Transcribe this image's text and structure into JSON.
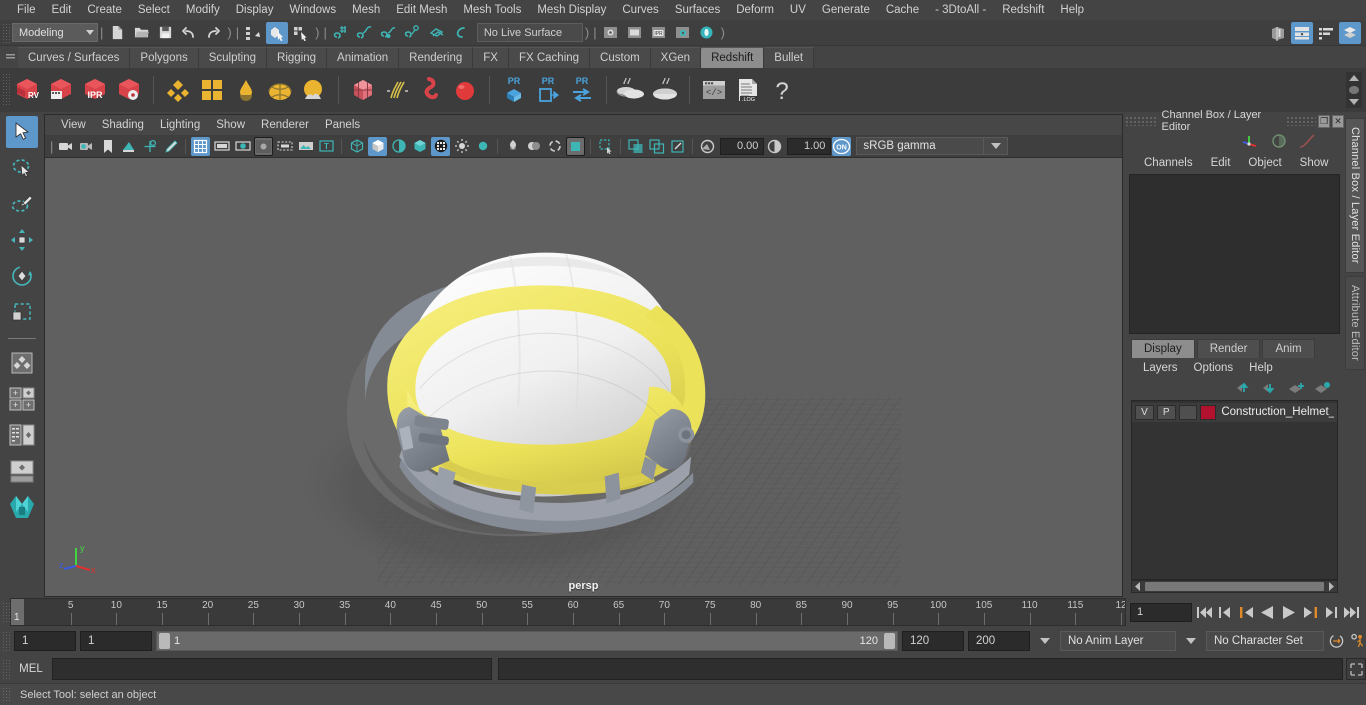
{
  "menubar": {
    "items": [
      "File",
      "Edit",
      "Create",
      "Select",
      "Modify",
      "Display",
      "Windows",
      "Mesh",
      "Edit Mesh",
      "Mesh Tools",
      "Mesh Display",
      "Curves",
      "Surfaces",
      "Deform",
      "UV",
      "Generate",
      "Cache",
      "- 3DtoAll -",
      "Redshift",
      "Help"
    ]
  },
  "statusline": {
    "menuset": "Modeling",
    "live_surface": "No Live Surface",
    "icons": [
      "new-scene-icon",
      "open-scene-icon",
      "save-scene-icon",
      "undo-icon",
      "redo-icon",
      "select-by-hierarchy-icon",
      "select-by-object-icon",
      "select-by-component-icon",
      "snap-to-grid-icon",
      "snap-to-curve-icon",
      "snap-to-point-icon",
      "snap-to-projected-center-icon",
      "snap-to-view-plane-icon",
      "make-live-icon",
      "render-view-icon",
      "render-current-frame-icon",
      "ipr-render-icon",
      "render-settings-icon",
      "hypershade-icon",
      "show-hide-editors-icon",
      "attribute-editor-toggle-icon",
      "tool-settings-toggle-icon",
      "channel-box-toggle-icon"
    ]
  },
  "shelf": {
    "tabs": [
      "Curves / Surfaces",
      "Polygons",
      "Sculpting",
      "Rigging",
      "Animation",
      "Rendering",
      "FX",
      "FX Caching",
      "Custom",
      "XGen",
      "Redshift",
      "Bullet"
    ],
    "active_tab": "Redshift",
    "buttons": [
      "redshift-render-view-icon",
      "redshift-render-sequence-icon",
      "redshift-ipr-icon",
      "redshift-render-settings-icon",
      "redshift-material-icon",
      "redshift-material-blender-icon",
      "redshift-light-icon",
      "redshift-dome-light-icon",
      "redshift-environment-icon",
      "redshift-proxy-icon",
      "redshift-hair-icon",
      "redshift-volume-icon",
      "redshift-sphere-icon",
      "redshift-pr-bake-icon",
      "redshift-pr-export-icon",
      "redshift-pr-transfer-icon",
      "redshift-bake-set-icon",
      "redshift-bake-icon",
      "redshift-script-icon",
      "redshift-log-icon",
      "redshift-help-icon"
    ]
  },
  "toolbox": {
    "items": [
      {
        "name": "select-tool",
        "selected": true
      },
      {
        "name": "lasso-select-tool",
        "selected": false
      },
      {
        "name": "paint-select-tool",
        "selected": false
      },
      {
        "name": "move-tool",
        "selected": false
      },
      {
        "name": "rotate-tool",
        "selected": false
      },
      {
        "name": "scale-tool",
        "selected": false
      },
      {
        "name": "last-tool-used",
        "selected": false
      },
      {
        "name": "four-view-layout",
        "selected": false
      },
      {
        "name": "persp-outliner-layout",
        "selected": false
      },
      {
        "name": "hypergraph-layout",
        "selected": false
      },
      {
        "name": "single-persp-layout",
        "selected": false
      },
      {
        "name": "maya-logo-icon",
        "selected": false
      }
    ]
  },
  "viewport": {
    "menu": [
      "View",
      "Shading",
      "Lighting",
      "Show",
      "Renderer",
      "Panels"
    ],
    "toolbar_icons": [
      "select-camera-icon",
      "camera-attributes-icon",
      "bookmark-icon",
      "image-plane-icon",
      "two-d-pan-zoom-icon",
      "grease-pencil-icon",
      "grid-toggle-icon",
      "film-gate-icon",
      "resolution-gate-icon",
      "gate-mask-icon",
      "film-origin-icon",
      "exposure-icon",
      "xray-text-icon",
      "wireframe-shading-icon",
      "smooth-shade-all-icon",
      "smooth-shade-selected-icon",
      "use-all-lights-icon",
      "shadows-icon",
      "screen-space-ao-icon",
      "motion-blur-icon",
      "multisample-icon",
      "depth-of-field-icon",
      "xray-icon",
      "xray-joints-icon",
      "xray-active-components-icon",
      "isolate-select-icon",
      "display-textures-icon",
      "display-layer-icon",
      "display-hud-icon",
      "exposure-control-icon",
      "gamma-control-icon",
      "color-management-toggle-icon"
    ],
    "exposure_value": "0.00",
    "gamma_value": "1.00",
    "color_profile": "sRGB gamma",
    "camera_label": "persp",
    "axis_labels": {
      "x": "x",
      "y": "y",
      "z": "z"
    },
    "background_color": "#606060"
  },
  "channel_box": {
    "title": "Channel Box / Layer Editor",
    "menu": [
      "Channels",
      "Edit",
      "Object",
      "Show"
    ],
    "window_buttons": [
      "restore-icon",
      "close-icon"
    ],
    "header_icons": [
      "show-manipulator-icon",
      "toggle-attribute-icon",
      "speed-curve-icon"
    ]
  },
  "layer_editor": {
    "tabs": [
      "Display",
      "Render",
      "Anim"
    ],
    "active_tab": "Display",
    "menu": [
      "Layers",
      "Options",
      "Help"
    ],
    "buttons": [
      "move-layer-up-icon",
      "move-layer-down-icon",
      "new-layer-icon",
      "new-layer-from-selected-icon"
    ],
    "layers": [
      {
        "visibility": "V",
        "playback": "P",
        "shading": "",
        "color": "#b3122f",
        "name": "Construction_Helmet_"
      }
    ]
  },
  "right_vtabs": [
    {
      "label": "Channel Box / Layer Editor",
      "active": true
    },
    {
      "label": "Attribute Editor",
      "active": false
    }
  ],
  "timeslider": {
    "tick_labels": [
      "5",
      "10",
      "15",
      "20",
      "25",
      "30",
      "35",
      "40",
      "45",
      "50",
      "55",
      "60",
      "65",
      "70",
      "75",
      "80",
      "85",
      "90",
      "95",
      "100",
      "105",
      "110",
      "115",
      "12"
    ],
    "current_frame_marker": "1",
    "current_frame_field": "1",
    "playback_buttons": [
      "go-to-start-icon",
      "step-back-keyframe-icon",
      "step-back-frame-icon",
      "play-backwards-icon",
      "play-forwards-icon",
      "step-forward-frame-icon",
      "step-forward-keyframe-icon",
      "go-to-end-icon"
    ]
  },
  "rangeslider": {
    "anim_start": "1",
    "range_start": "1",
    "bar_start_label": "1",
    "bar_end_label": "120",
    "range_end": "120",
    "anim_end": "200",
    "anim_layer": "No Anim Layer",
    "character_set": "No Character Set",
    "buttons": [
      "auto-keyframe-icon",
      "animation-preferences-icon"
    ]
  },
  "commandline": {
    "language_label": "MEL",
    "input_value": "",
    "output_value": "",
    "expand_button": "script-editor-icon"
  },
  "helpline": {
    "text": "Select Tool: select an object"
  },
  "colors": {
    "accent_blue": "#5e97c9",
    "shelf_red": "#d8434a",
    "shelf_yellow": "#eab430",
    "teal": "#43b9bd",
    "helmet_yellow": "#eee45f",
    "helmet_white": "#f2f2f2",
    "helmet_grey": "#8d929c"
  }
}
